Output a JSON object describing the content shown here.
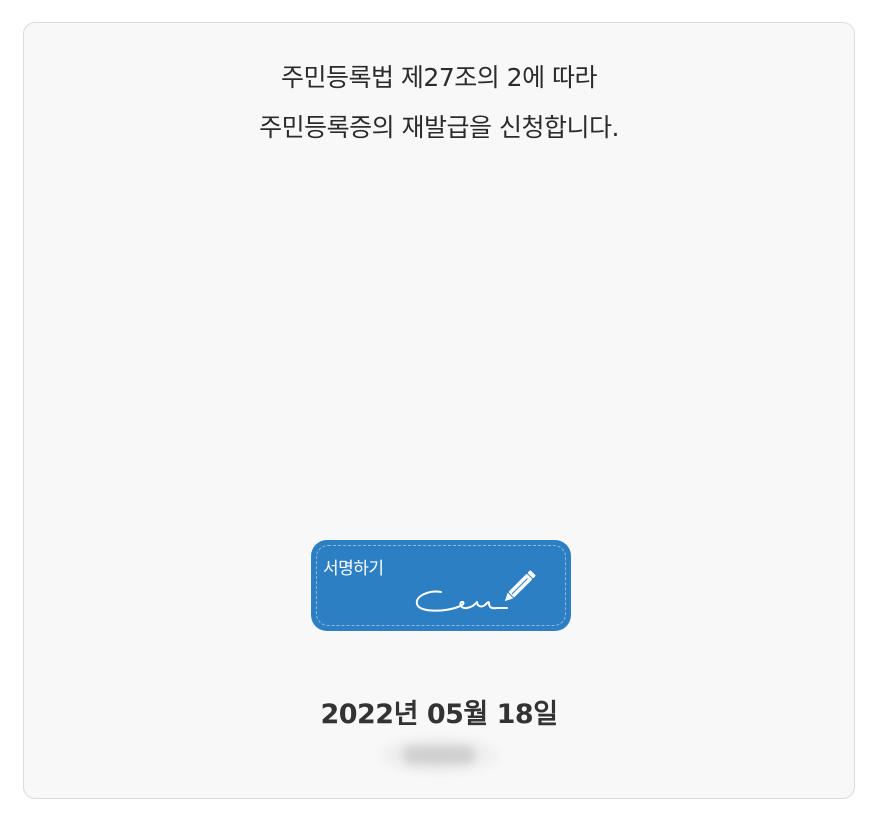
{
  "statement": {
    "line1": "주민등록법 제27조의 2에 따라",
    "line2": "주민등록증의 재발급을 신청합니다."
  },
  "sign_button": {
    "label": "서명하기",
    "icon": "signature-pen-icon"
  },
  "date": "2022년 05월 18일",
  "colors": {
    "card_background": "#f8f8f8",
    "button_blue": "#2d7fc4",
    "text": "#2b2b2b"
  }
}
